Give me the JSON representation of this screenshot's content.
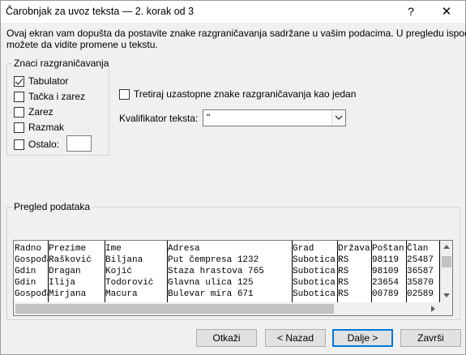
{
  "window": {
    "title": "Čarobnjak za uvoz teksta — 2. korak od 3",
    "help_glyph": "?",
    "close_glyph": "✕"
  },
  "description": {
    "line1": "Ovaj ekran vam dopušta da postavite znake razgraničavanja sadržane u vašim podacima. U pregledu ispod",
    "line2": "možete da vidite promene u tekstu."
  },
  "delimiters": {
    "group_title": "Znaci razgraničavanja",
    "items": [
      {
        "label": "Tabulator",
        "checked": true
      },
      {
        "label": "Tačka i zarez",
        "checked": false
      },
      {
        "label": "Zarez",
        "checked": false
      },
      {
        "label": "Razmak",
        "checked": false
      },
      {
        "label": "Ostalo:",
        "checked": false
      }
    ],
    "other_value": ""
  },
  "consecutive": {
    "label": "Tretiraj uzastopne znake razgraničavanja kao jedan",
    "checked": false
  },
  "qualifier": {
    "label": "Kvalifikator teksta:",
    "value": "\""
  },
  "preview": {
    "title": "Pregled podataka",
    "columns": [
      "Radno",
      "Prezime",
      "Ime",
      "Adresa",
      "Grad",
      "Država",
      "Poštan",
      "Član"
    ],
    "rows": [
      [
        "Gospođa",
        "Rašković",
        "Biljana",
        "Put čempresa 1232",
        "Subotica",
        "RS",
        "98119",
        "25487"
      ],
      [
        "Gdin",
        "Dragan",
        "Kojić",
        "Staza hrastova 765",
        "Subotica",
        "RS",
        "98109",
        "36587"
      ],
      [
        "Gdin",
        "Ilija",
        "Todorović",
        "Glavna ulica 125",
        "Subotica",
        "RS",
        "23654",
        "35870"
      ],
      [
        "Gospođa",
        "Mirjana",
        "Macura",
        "Bulevar mira 671",
        "Subotica",
        "RS",
        "00789",
        "02589"
      ]
    ]
  },
  "buttons": {
    "cancel": "Otkaži",
    "back": "< Nazad",
    "next": "Dalje >",
    "finish": "Završi"
  }
}
